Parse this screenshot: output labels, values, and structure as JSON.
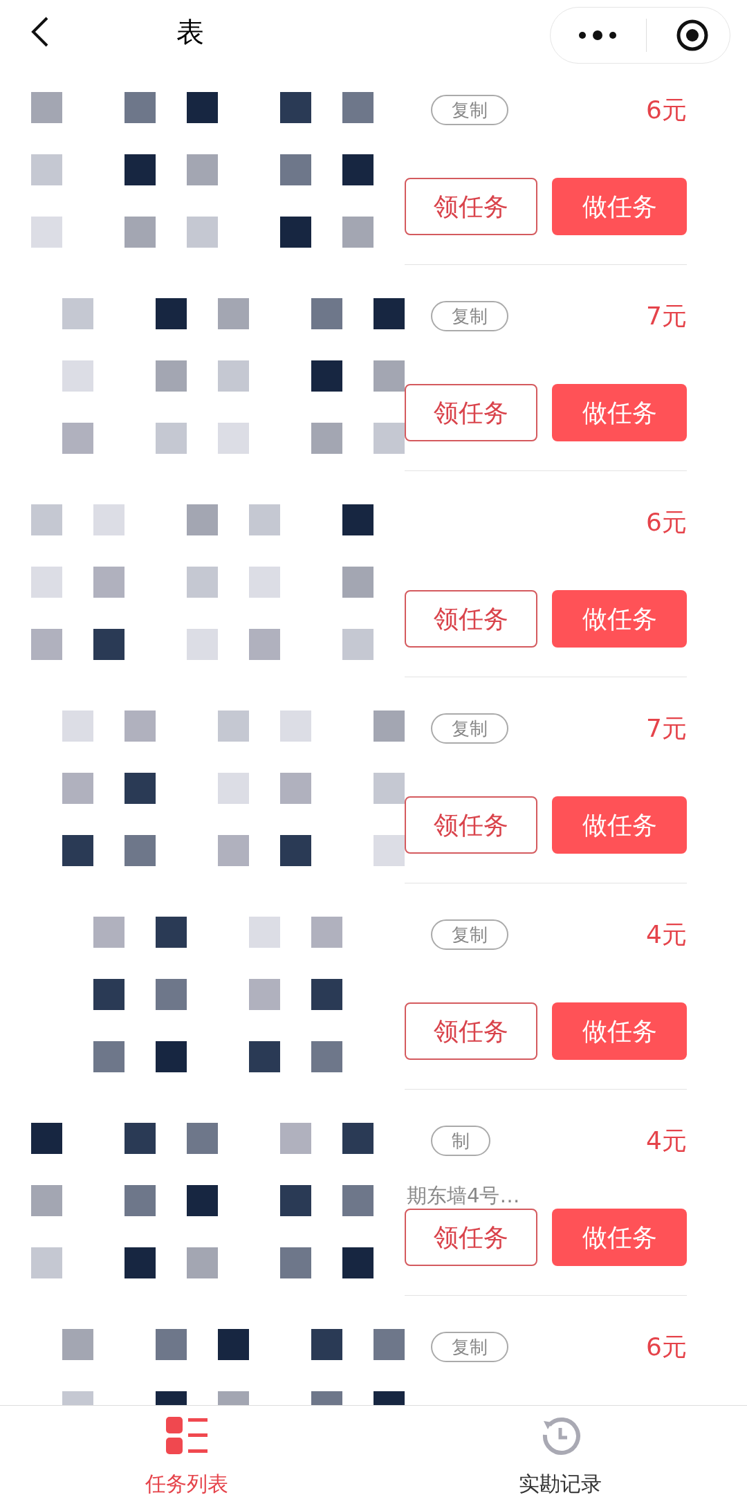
{
  "header": {
    "title": "表"
  },
  "tasks": [
    {
      "copy_label": "复制",
      "price": "6元",
      "claim_label": "领任务",
      "do_label": "做任务"
    },
    {
      "copy_label": "复制",
      "price": "7元",
      "claim_label": "领任务",
      "do_label": "做任务"
    },
    {
      "price": "6元",
      "claim_label": "领任务",
      "do_label": "做任务"
    },
    {
      "copy_label": "复制",
      "price": "7元",
      "claim_label": "领任务",
      "do_label": "做任务"
    },
    {
      "copy_label": "复制",
      "price": "4元",
      "claim_label": "领任务",
      "do_label": "做任务"
    },
    {
      "copy_label": "制",
      "price": "4元",
      "address": "期东墙4号…",
      "claim_label": "领任务",
      "do_label": "做任务"
    },
    {
      "copy_label": "复制",
      "price": "6元"
    }
  ],
  "tabs": [
    {
      "label": "任务列表",
      "selected": true
    },
    {
      "label": "实勘记录",
      "selected": false
    }
  ]
}
